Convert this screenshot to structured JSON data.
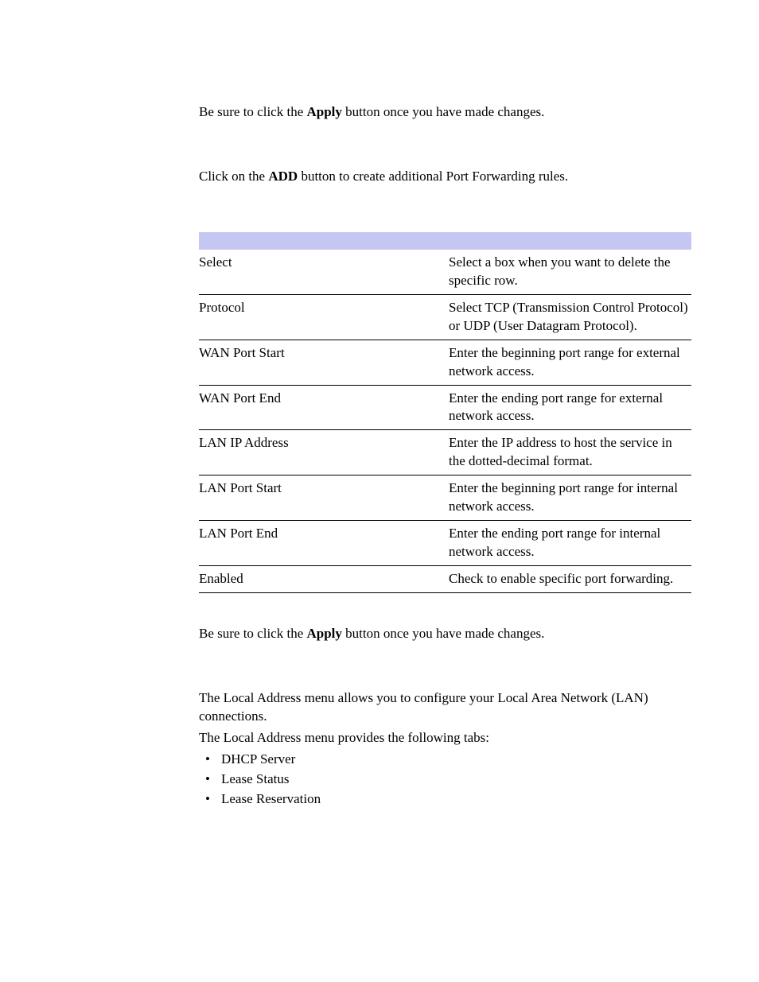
{
  "para1": {
    "pre": "Be sure to click the ",
    "bold": "Apply",
    "post": " button once you have made changes."
  },
  "para2": {
    "pre": "Click on the ",
    "bold": "ADD",
    "post": " button to create additional Port Forwarding rules."
  },
  "table_rows": [
    {
      "label": "Select",
      "desc": "Select a box when you want to delete the specific row."
    },
    {
      "label": "Protocol",
      "desc": "Select TCP (Transmission Control Protocol) or UDP (User Datagram Protocol)."
    },
    {
      "label": "WAN Port Start",
      "desc": "Enter the beginning port range for external network access."
    },
    {
      "label": "WAN Port End",
      "desc": "Enter the ending port range for external network access."
    },
    {
      "label": "LAN IP Address",
      "desc": "Enter the IP address to host the service in the dotted-decimal format."
    },
    {
      "label": "LAN Port Start",
      "desc": "Enter the beginning port range for internal network access."
    },
    {
      "label": "LAN Port End",
      "desc": "Enter the ending port range for internal network access."
    },
    {
      "label": "Enabled",
      "desc": "Check to enable specific port forwarding."
    }
  ],
  "para3": {
    "pre": "Be sure to click the ",
    "bold": "Apply",
    "post": " button once you have made changes."
  },
  "para4": "The Local Address menu allows you to configure your Local Area Network (LAN) connections.",
  "para5": "The Local Address menu provides the following tabs:",
  "tabs": [
    "DHCP Server",
    "Lease Status",
    "Lease Reservation"
  ]
}
